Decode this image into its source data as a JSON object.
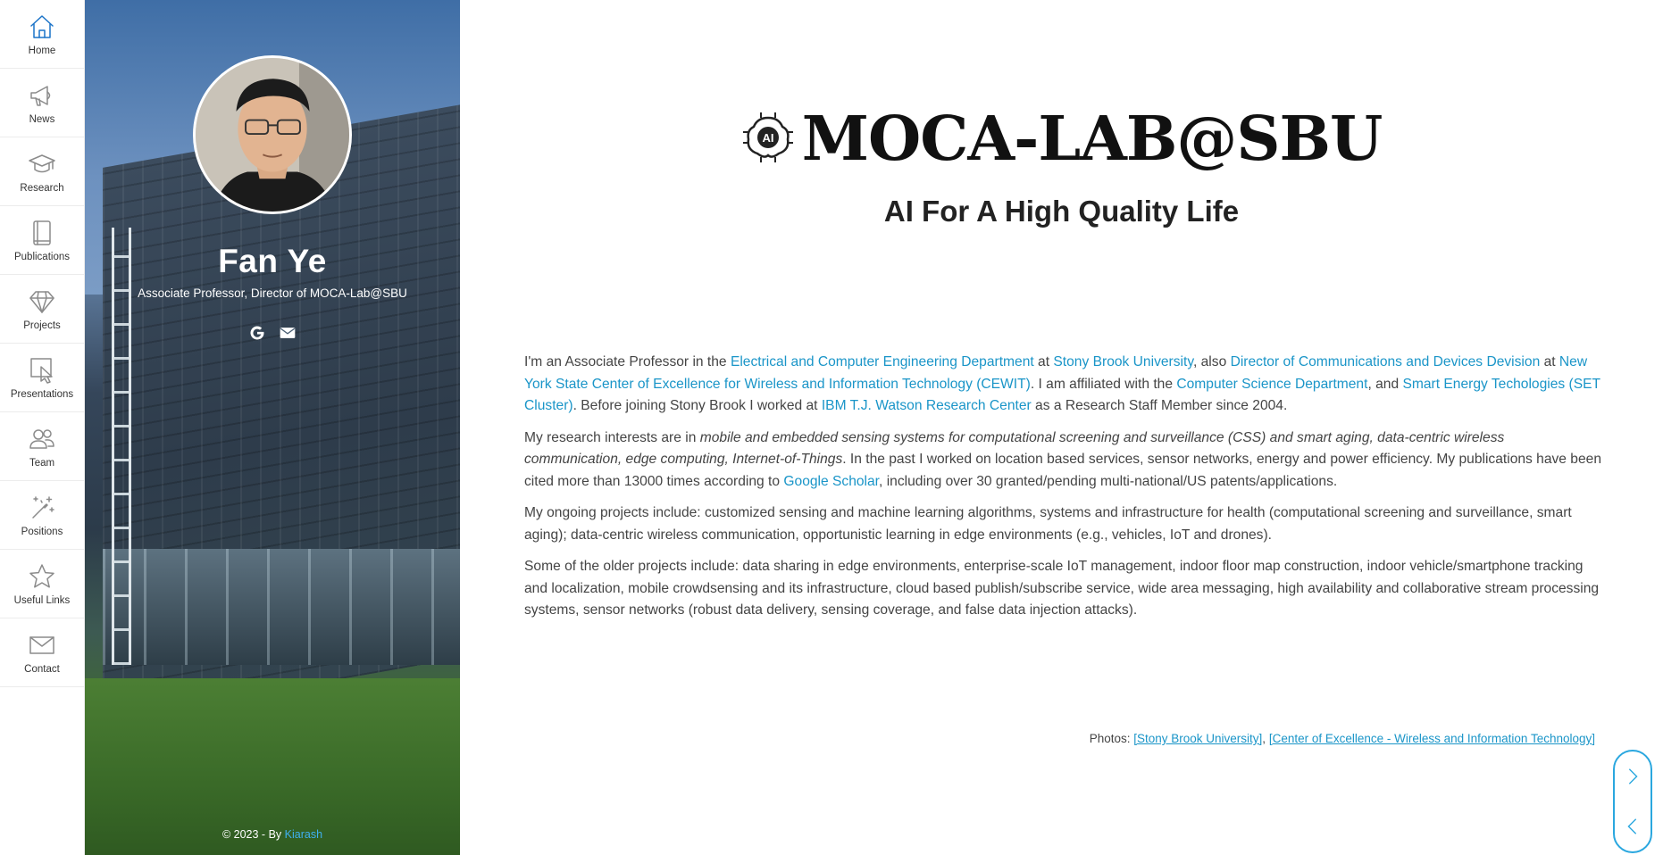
{
  "nav": {
    "items": [
      {
        "label": "Home",
        "icon": "home-icon"
      },
      {
        "label": "News",
        "icon": "megaphone-icon"
      },
      {
        "label": "Research",
        "icon": "graduation-cap-icon"
      },
      {
        "label": "Publications",
        "icon": "book-icon"
      },
      {
        "label": "Projects",
        "icon": "diamond-icon"
      },
      {
        "label": "Presentations",
        "icon": "pointer-icon"
      },
      {
        "label": "Team",
        "icon": "users-icon"
      },
      {
        "label": "Positions",
        "icon": "magic-wand-icon"
      },
      {
        "label": "Useful Links",
        "icon": "star-icon"
      },
      {
        "label": "Contact",
        "icon": "envelope-icon"
      }
    ],
    "active_color": "#1a73c8"
  },
  "profile": {
    "name": "Fan Ye",
    "title": "Associate Professor, Director of MOCA-Lab@SBU",
    "social": [
      "google-icon",
      "envelope-icon"
    ],
    "footer_prefix": "© 2023 - By ",
    "footer_author": "Kiarash"
  },
  "header": {
    "logo_text": "AI",
    "title": "MOCA-LAB@SBU",
    "tagline": "AI For A High Quality Life"
  },
  "content": {
    "p1": {
      "t1": "I'm an Associate Professor in the ",
      "l1": "Electrical and Computer Engineering Department",
      "t2": " at ",
      "l2": "Stony Brook University",
      "t3": ", also ",
      "l3": "Director of Communications and Devices Devision",
      "t4": " at ",
      "l4": "New York State Center of Excellence for Wireless and Information Technology (CEWIT)",
      "t5": ". I am affiliated with the ",
      "l5": "Computer Science Department",
      "t6": ", and ",
      "l6": "Smart Energy Techologies (SET Cluster)",
      "t7": ". Before joining Stony Brook I worked at ",
      "l7": "IBM T.J. Watson Research Center",
      "t8": " as a Research Staff Member since 2004."
    },
    "p2": {
      "t1": "My research interests are in ",
      "em": "mobile and embedded sensing systems for computational screening and surveillance (CSS) and smart aging, data-centric wireless communication, edge computing, Internet-of-Things",
      "t2": ". In the past I worked on location based services, sensor networks, energy and power efficiency. My publications have been cited more than 13000 times according to ",
      "l1": "Google Scholar",
      "t3": ", including over 30 granted/pending multi-national/US patents/applications."
    },
    "p3": "My ongoing projects include: customized sensing and machine learning algorithms, systems and infrastructure for health (computational screening and surveillance, smart aging); data-centric wireless communication, opportunistic learning in edge environments (e.g., vehicles, IoT and drones).",
    "p4": "Some of the older projects include: data sharing in edge environments, enterprise-scale IoT management, indoor floor map construction, indoor vehicle/smartphone tracking and localization, mobile crowdsensing and its infrastructure, cloud based publish/subscribe service, wide area messaging, high availability and collaborative stream processing systems, sensor networks (robust data delivery, sensing coverage, and false data injection attacks).",
    "photos_label": "Photos: ",
    "photo_link1": "[Stony Brook University]",
    "photo_sep": ", ",
    "photo_link2": "[Center of Excellence - Wireless and Information Technology]"
  },
  "slider": {
    "next": "chevron-right-icon",
    "prev": "chevron-left-icon"
  },
  "colors": {
    "link": "#1a95c8",
    "accent": "#2aa7df",
    "footer_link": "#3fb0f0"
  }
}
